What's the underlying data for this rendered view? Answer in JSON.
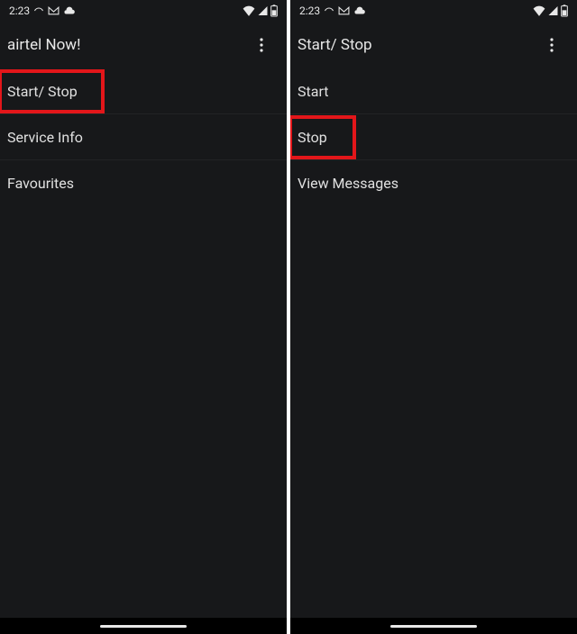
{
  "status": {
    "time": "2:23",
    "icons_left": [
      "phone-curve",
      "gmail",
      "cloud"
    ],
    "icons_right": [
      "wifi",
      "signal",
      "battery"
    ]
  },
  "left_screen": {
    "title": "airtel Now!",
    "items": [
      {
        "label": "Start/ Stop",
        "highlighted": true
      },
      {
        "label": "Service Info",
        "highlighted": false
      },
      {
        "label": "Favourites",
        "highlighted": false
      }
    ]
  },
  "right_screen": {
    "title": "Start/ Stop",
    "items": [
      {
        "label": "Start",
        "highlighted": false
      },
      {
        "label": "Stop",
        "highlighted": true
      },
      {
        "label": "View Messages",
        "highlighted": false
      }
    ]
  }
}
